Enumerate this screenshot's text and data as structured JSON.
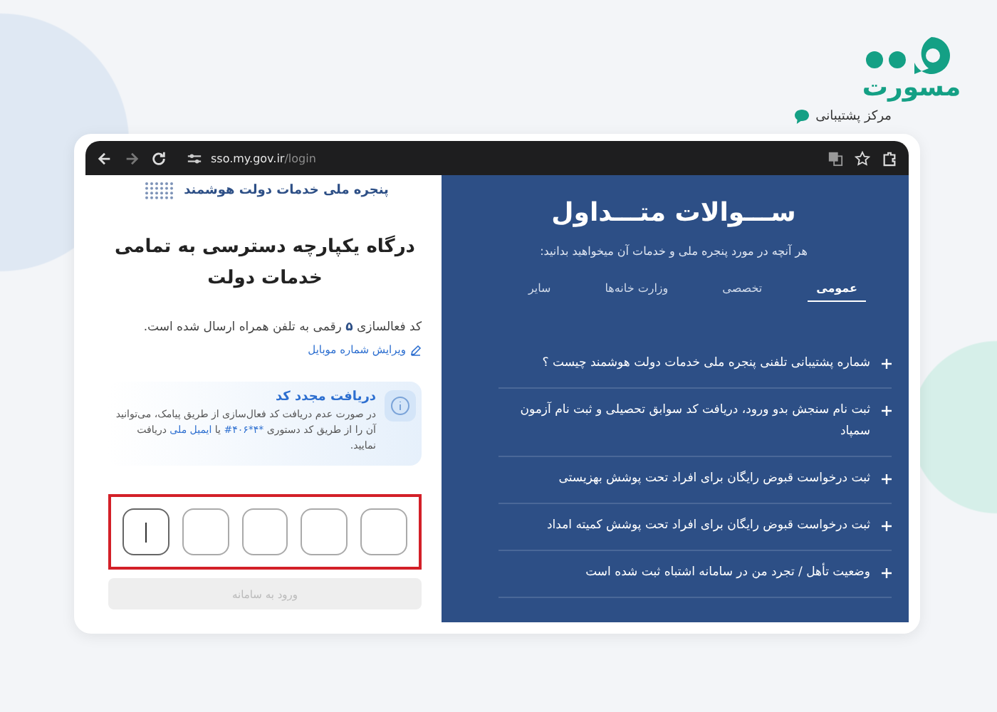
{
  "brand": {
    "logo_text": "مسورت",
    "support_label": "مرکز پشتیبانی"
  },
  "browser": {
    "url_host": "sso.my.gov.ir",
    "url_path": "/login"
  },
  "login_panel": {
    "portal_name": "پنجره ملی خدمات دولت هوشمند",
    "title": "درگاه یکپارچه دسترسی به تمامی خدمات دولت",
    "message": "کد فعالسازی **۵** رقمی به تلفن همراه ارسال شده است.",
    "edit_link": "ویرایش شماره موبایل",
    "resend": {
      "title": "دریافت مجدد کد",
      "segments": [
        {
          "kind": "plain",
          "text": "در صورت عدم دریافت کد فعال‌سازی از طریق پیامک، می‌توانید آن را از طریق کد دستوری "
        },
        {
          "kind": "link",
          "text": "*۴*۴۰۶#"
        },
        {
          "kind": "plain",
          "text": " یا "
        },
        {
          "kind": "link",
          "text": "ایمیل ملی"
        },
        {
          "kind": "plain",
          "text": " دریافت نمایید."
        }
      ]
    },
    "otp_boxes": [
      {
        "focused": false
      },
      {
        "focused": false
      },
      {
        "focused": false
      },
      {
        "focused": false
      },
      {
        "focused": true
      }
    ],
    "submit": {
      "label": "ورود به سامانه",
      "disabled": true
    }
  },
  "faq_panel": {
    "title": "ســـوالات متـــداول",
    "subtitle": "هر آنچه در مورد پنجره ملی و خدمات آن میخواهید بدانید:",
    "tabs": [
      {
        "label": "عمومی",
        "selected": true
      },
      {
        "label": "تخصصی",
        "selected": false
      },
      {
        "label": "وزارت خانه‌ها",
        "selected": false
      },
      {
        "label": "سایر",
        "selected": false
      }
    ],
    "questions": [
      "شماره پشتیبانی تلفنی پنجره ملی خدمات دولت هوشمند چیست ؟",
      "ثبت نام سنجش بدو ورود، دریافت کد سوابق تحصیلی و ثبت نام آزمون سمپاد",
      "ثبت درخواست قبوض رایگان برای افراد تحت پوشش بهزیستی",
      "ثبت درخواست قبوض رایگان برای افراد تحت پوشش کمیته امداد",
      "وضعیت تأهل / تجرد من در سامانه اشتباه ثبت شده است"
    ]
  }
}
